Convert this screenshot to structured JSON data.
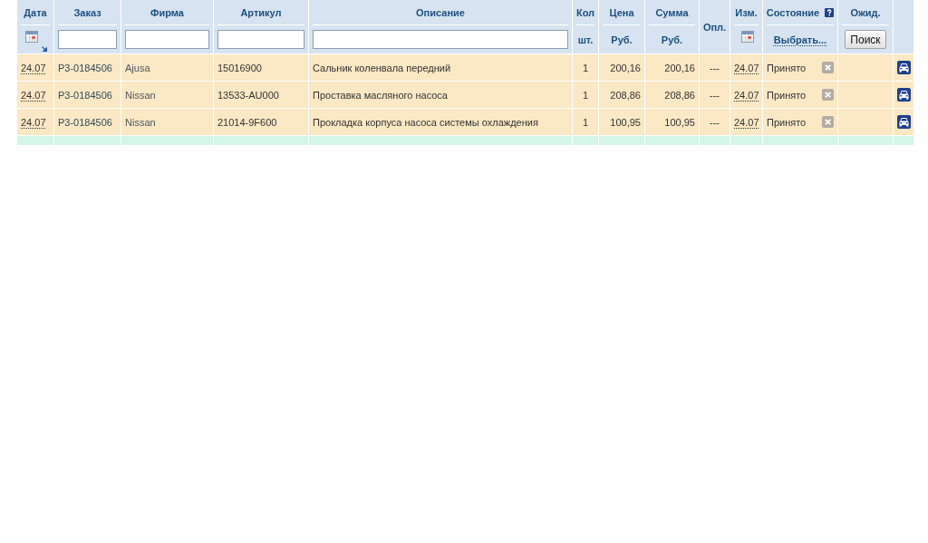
{
  "table": {
    "columns": [
      {
        "label": "Дата",
        "filter": {
          "kind": "date"
        },
        "sorted": true,
        "help": false
      },
      {
        "label": "Заказ",
        "filter": {
          "kind": "input"
        },
        "sorted": false,
        "help": false
      },
      {
        "label": "Фирма",
        "filter": {
          "kind": "input"
        },
        "sorted": false,
        "help": false
      },
      {
        "label": "Артикул",
        "filter": {
          "kind": "input"
        },
        "sorted": false,
        "help": false
      },
      {
        "label": "Описание",
        "filter": {
          "kind": "input"
        },
        "sorted": false,
        "help": false
      },
      {
        "label": "Кол",
        "filter": {
          "kind": "unit",
          "text": "шт."
        },
        "sorted": false,
        "help": false
      },
      {
        "label": "Цена",
        "filter": {
          "kind": "unit",
          "text": "Руб."
        },
        "sorted": false,
        "help": false
      },
      {
        "label": "Сумма",
        "filter": {
          "kind": "unit",
          "text": "Руб."
        },
        "sorted": false,
        "help": false
      },
      {
        "label": "Опл.",
        "sorted": false,
        "help": false
      },
      {
        "label": "Изм.",
        "filter": {
          "kind": "date"
        },
        "sorted": false,
        "help": false
      },
      {
        "label": "Состояние",
        "filter": {
          "kind": "link",
          "text": "Выбрать..."
        },
        "sorted": false,
        "help": true
      },
      {
        "label": "Ожид.",
        "filter": {
          "kind": "button",
          "text": "Поиск"
        },
        "sorted": false,
        "help": false
      }
    ],
    "rows": [
      {
        "date": "24.07",
        "order": "P3-0184506",
        "brand": "Ajusa",
        "article": "15016900",
        "description": "Сальник коленвала передний",
        "qty": "1",
        "price": "200,16",
        "sum": "200,16",
        "paid": "---",
        "changed": "24.07",
        "status": "Принято",
        "color": "#fbe8c4"
      },
      {
        "date": "24.07",
        "order": "P3-0184506",
        "brand": "Nissan",
        "article": "13533-AU000",
        "description": "Проставка масляного насоса",
        "qty": "1",
        "price": "208,86",
        "sum": "208,86",
        "paid": "---",
        "changed": "24.07",
        "status": "Принято",
        "color": "#fbe8c4"
      },
      {
        "date": "24.07",
        "order": "P3-0184506",
        "brand": "Nissan",
        "article": "21014-9F600",
        "description": "Прокладка корпуса насоса системы охлаждения",
        "qty": "1",
        "price": "100,95",
        "sum": "100,95",
        "paid": "---",
        "changed": "24.07",
        "status": "Принято",
        "color": "#fbe8c4"
      },
      {
        "color": "#d4f6e8"
      }
    ]
  }
}
